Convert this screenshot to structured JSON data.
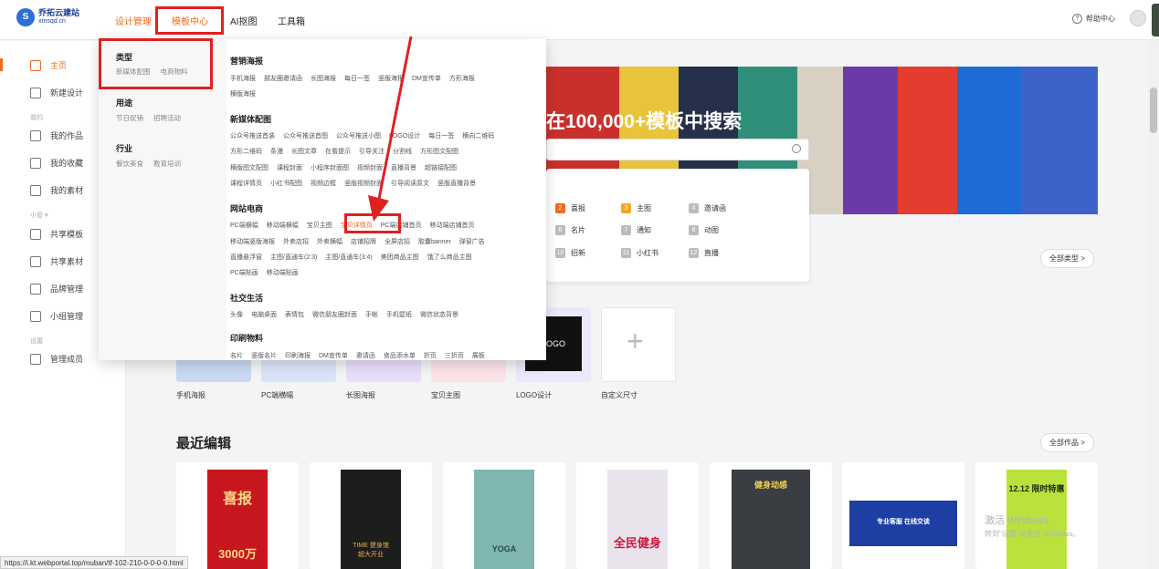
{
  "brand": {
    "logo_mark": "S",
    "name": "乔拓云建站",
    "domain": "xmsqd.cn"
  },
  "topnav": [
    {
      "label": "设计管理",
      "active": true
    },
    {
      "label": "模板中心",
      "active": true
    },
    {
      "label": "AI抠图",
      "active": false
    },
    {
      "label": "工具箱",
      "active": false
    }
  ],
  "help": {
    "icon": "?",
    "label": "帮助中心"
  },
  "sidebar": {
    "items": [
      {
        "label": "主页",
        "icon": "home-icon"
      },
      {
        "label": "新建设计",
        "icon": "new-file-icon"
      }
    ],
    "group_mine": "我的",
    "mine_items": [
      {
        "label": "我的作品",
        "icon": "gear-icon"
      },
      {
        "label": "我的收藏",
        "icon": "star-icon"
      },
      {
        "label": "我的素材",
        "icon": "image-icon"
      }
    ],
    "group_team": "小管 ▾",
    "team_items": [
      {
        "label": "共享模板",
        "icon": "template-icon"
      },
      {
        "label": "共享素材",
        "icon": "folder-icon"
      },
      {
        "label": "品牌管理",
        "icon": "brand-icon"
      },
      {
        "label": "小组管理",
        "icon": "team-icon"
      }
    ],
    "group_settings": "设置",
    "settings_items": [
      {
        "label": "管理成员",
        "icon": "members-icon"
      }
    ]
  },
  "banner": {
    "title": "在100,000+模板中搜索"
  },
  "categories": [
    {
      "num": "2",
      "label": "喜报",
      "color": "#f26a1b"
    },
    {
      "num": "3",
      "label": "主图",
      "color": "#f5a623"
    },
    {
      "num": "4",
      "label": "邀请函",
      "color": "#bbbbbb"
    },
    {
      "num": "6",
      "label": "名片",
      "color": "#bbbbbb"
    },
    {
      "num": "7",
      "label": "通知",
      "color": "#bbbbbb"
    },
    {
      "num": "8",
      "label": "动图",
      "color": "#bbbbbb"
    },
    {
      "num": "10",
      "label": "招新",
      "color": "#bbbbbb"
    },
    {
      "num": "11",
      "label": "小红书",
      "color": "#bbbbbb"
    },
    {
      "num": "12",
      "label": "直播",
      "color": "#bbbbbb"
    }
  ],
  "all_types_button": "全部类型 >",
  "templates": [
    {
      "label": "手机海报"
    },
    {
      "label": "PC端横幅"
    },
    {
      "label": "长图海报"
    },
    {
      "label": "宝贝主图"
    },
    {
      "label": "LOGO设计"
    },
    {
      "label": "自定义尺寸"
    }
  ],
  "recent": {
    "title": "最近编辑",
    "all_button": "全部作品 >"
  },
  "dropdown": {
    "left": [
      {
        "head": "类型",
        "subs": [
          "新媒体配图",
          "电商物料"
        ]
      },
      {
        "head": "用途",
        "subs": [
          "节日促销",
          "招聘活动"
        ]
      },
      {
        "head": "行业",
        "subs": [
          "餐饮美食",
          "教育培训"
        ]
      }
    ],
    "sections": [
      {
        "title": "营销海报",
        "lines": [
          [
            "手机海报",
            "朋友圈邀请函",
            "长图海报",
            "每日一签",
            "竖版海报",
            "DM宣传单",
            "方形海报"
          ],
          [
            "横版海报"
          ]
        ]
      },
      {
        "title": "新媒体配图",
        "lines": [
          [
            "公众号推送首装",
            "公众号推送首图",
            "公众号推送小图",
            "LOGO设计",
            "每日一签",
            "横向二维码"
          ],
          [
            "方形二维码",
            "条漫",
            "长图文章",
            "在看提示",
            "引导关注",
            "分割线",
            "方形图文配图"
          ],
          [
            "横版图文配图",
            "课程封面",
            "小程序封面图",
            "视频封面",
            "直播背景",
            "超链接配图"
          ],
          [
            "课程详情页",
            "小红书配图",
            "视频边框",
            "竖版视频封面",
            "引导阅读原文",
            "竖版直播背景"
          ]
        ]
      },
      {
        "title": "网站电商",
        "lines": [
          [
            "PC端横幅",
            "移动端横幅",
            "宝贝主图",
            "宝贝详情页",
            "PC端店铺首页",
            "移动端店铺首页"
          ],
          [
            "移动端竖版海报",
            "外卖店招",
            "外卖横幅",
            "店铺招牌",
            "全屏店招",
            "胶囊banner",
            "弹窗广告"
          ],
          [
            "直播悬浮窗",
            "主图/直通车(2:3)",
            "主图/直通车(3:4)",
            "美团商品主图",
            "饿了么商品主图"
          ],
          [
            "PC端贴画",
            "移动端贴画"
          ]
        ]
      },
      {
        "title": "社交生活",
        "lines": [
          [
            "头像",
            "电脑桌面",
            "表情包",
            "微信朋友圈封面",
            "手帐",
            "手机壁纸",
            "微信状态背景"
          ]
        ]
      },
      {
        "title": "印刷物料",
        "lines": [
          [
            "名片",
            "竖版名片",
            "印刷海报",
            "DM宣传单",
            "邀请函",
            "食品添水单",
            "折页",
            "三折页",
            "展板"
          ]
        ]
      }
    ]
  },
  "status_url": "https://i.kt.webportal.top/muban/tf-102-210-0-0-0-0.html",
  "watermark": {
    "line1": "激活 Windows",
    "line2": "转到\"设置\"以激活 Windows。"
  },
  "logo_card_text": "LOGO",
  "recent_posters": [
    "喜报",
    "TIME 健身馆",
    "YOGA",
    "全民健身",
    "健身动感",
    "专业客服 在线交谈",
    "12.12 限时特惠"
  ],
  "poster_texts": {
    "p1": "3000万",
    "p2": "超大开业"
  }
}
